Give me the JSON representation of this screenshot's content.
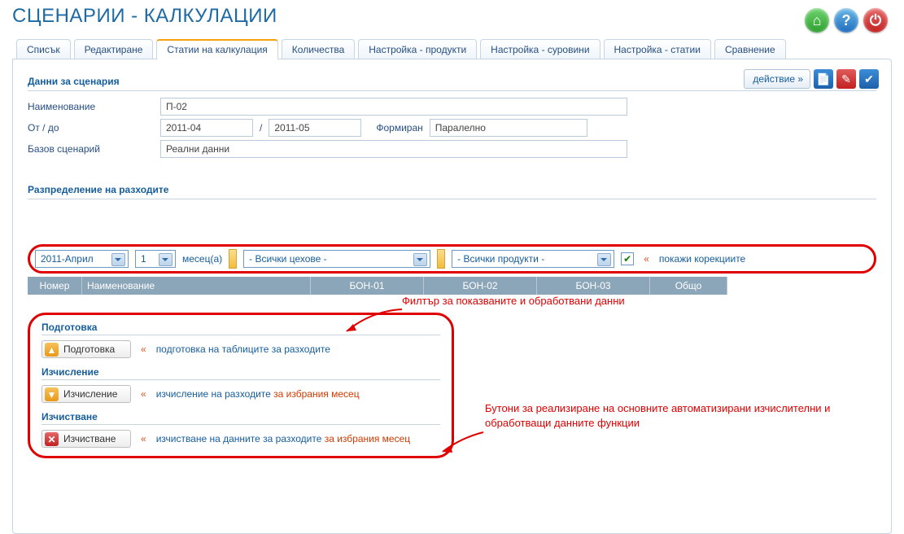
{
  "page_title": "СЦЕНАРИИ - КАЛКУЛАЦИИ",
  "header_icons": {
    "home": "⌂",
    "help": "?",
    "power": "⏻"
  },
  "tabs": [
    "Списък",
    "Редактиране",
    "Статии на калкулация",
    "Количества",
    "Настройка - продукти",
    "Настройка - суровини",
    "Настройка - статии",
    "Сравнение"
  ],
  "active_tab_index": 2,
  "section_data": "Данни за сценария",
  "action_button": "действие  »",
  "fields": {
    "name_label": "Наименование",
    "name_value": "П-02",
    "period_label": "От / до",
    "from": "2011-04",
    "to": "2011-05",
    "form_label": "Формиран",
    "form_value": "Паралелно",
    "base_label": "Базов сценарий",
    "base_value": "Реални данни"
  },
  "section_dist": "Разпределение на разходите",
  "annotation_top": "Филтър за показваните и обработвани данни",
  "filter": {
    "month": "2011-Април",
    "count": "1",
    "months_text": "месец(а)",
    "workshops": "- Всички цехове -",
    "products": "- Всички продукти -",
    "show_corr": "покажи корекциите"
  },
  "table_headers": [
    "Номер",
    "Наименование",
    "БОН-01",
    "БОН-02",
    "БОН-03",
    "Общо"
  ],
  "ops": {
    "prep_title": "Подготовка",
    "prep_btn": "Подготовка",
    "prep_desc": "подготовка на таблиците за разходите",
    "calc_title": "Изчисление",
    "calc_btn": "Изчисление",
    "calc_desc_a": "изчисление на разходите ",
    "calc_desc_b": "за избрания месец",
    "clr_title": "Изчистване",
    "clr_btn": "Изчистване",
    "clr_desc_a": "изчистване на данните за разходите ",
    "clr_desc_b": "за избрания месец"
  },
  "annotation_side": "Бутони за реализиране на основните автоматизирани изчислителни и обработващи данните функции",
  "angles": "«"
}
